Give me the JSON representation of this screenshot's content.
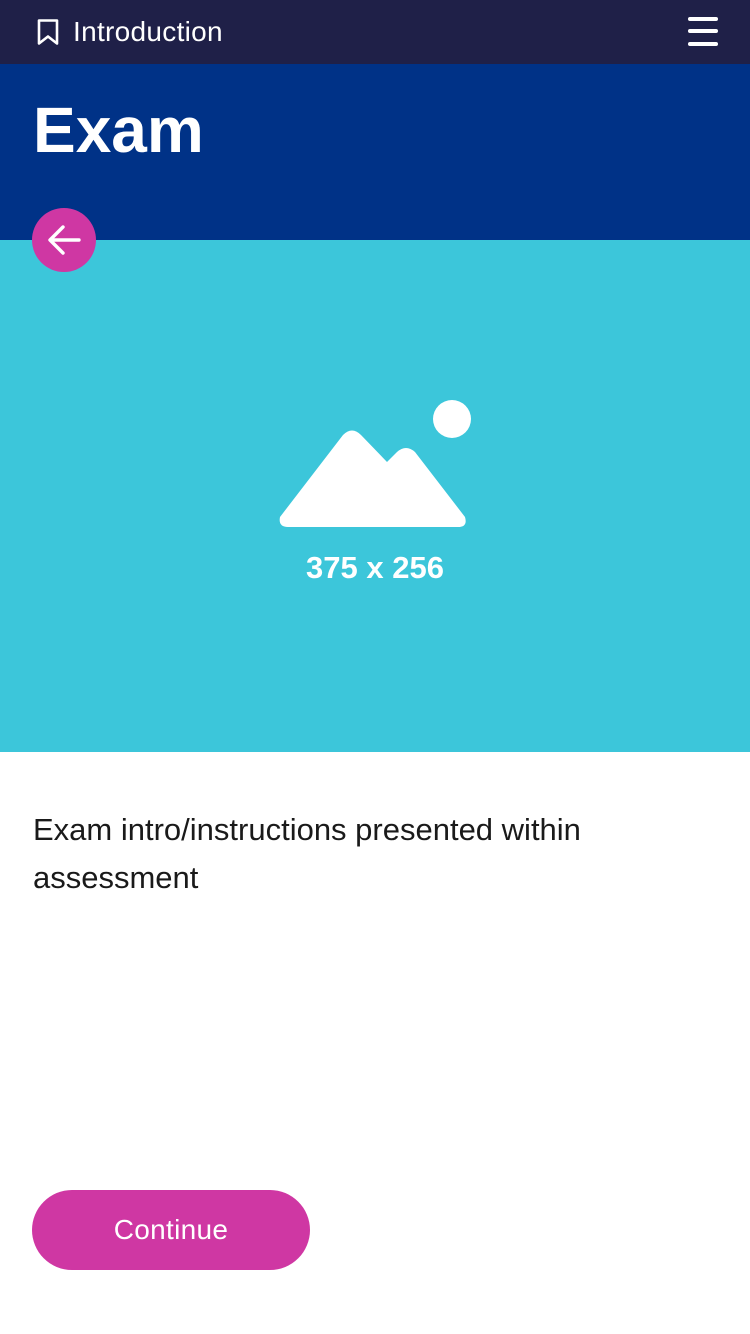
{
  "topbar": {
    "title": "Introduction",
    "bookmark_icon": "bookmark-icon",
    "menu_icon": "hamburger-menu-icon"
  },
  "header": {
    "title": "Exam",
    "back_icon": "arrow-left-icon"
  },
  "hero": {
    "placeholder_icon": "image-placeholder-icon",
    "dimensions_text": "375 x 256"
  },
  "main": {
    "intro_text": "Exam intro/instructions presented within assessment"
  },
  "actions": {
    "continue_label": "Continue"
  },
  "colors": {
    "topbar": "#1f2048",
    "header": "#003287",
    "hero": "#3cc6da",
    "accent": "#cf37a3",
    "text": "#1a1a1a"
  }
}
